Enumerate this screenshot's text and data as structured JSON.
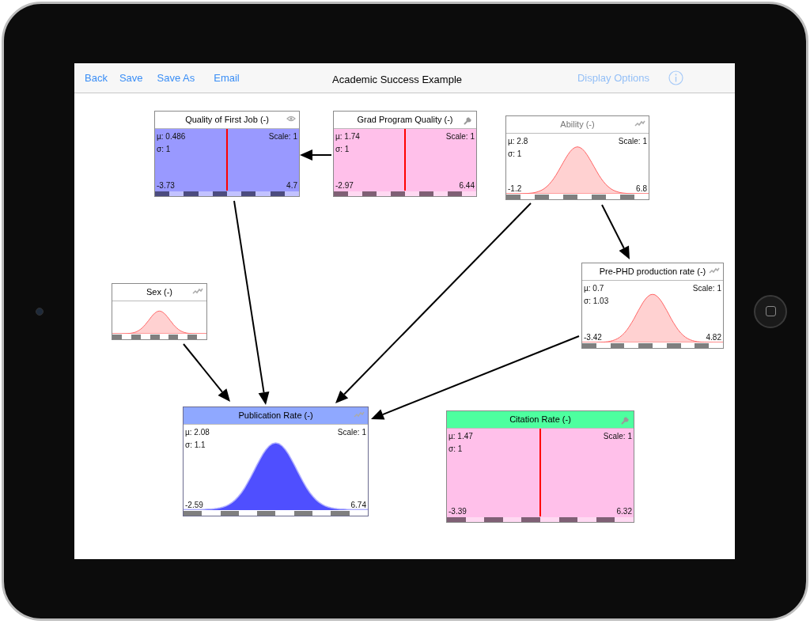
{
  "toolbar": {
    "left_buttons": [
      {
        "label": "Back"
      },
      {
        "label": "Save"
      },
      {
        "label": "Save As"
      },
      {
        "label": "Email"
      }
    ],
    "title": "Academic Success Example",
    "right_button": {
      "label": "Display Options",
      "disabled": true
    }
  },
  "nodes": [
    {
      "title": "Quality of First Job (-)",
      "kind": "observed",
      "dimmed": false,
      "selected": false,
      "highlighted": false,
      "mu": "µ: 0.486",
      "sigma": "σ: 1",
      "scale": "Scale: 1",
      "min": "-3.73",
      "max": "4.7"
    },
    {
      "title": "Grad Program Quality (-)",
      "kind": "fixed",
      "dimmed": false,
      "selected": false,
      "highlighted": false,
      "mu": "µ: 1.74",
      "sigma": "σ: 1",
      "scale": "Scale: 1",
      "min": "-2.97",
      "max": "6.44"
    },
    {
      "title": "Ability (-)",
      "kind": "distribution",
      "dimmed": true,
      "selected": false,
      "highlighted": false,
      "mu": "µ: 2.8",
      "sigma": "σ: 1",
      "scale": "Scale: 1",
      "min": "-1.2",
      "max": "6.8"
    },
    {
      "title": "Pre-PHD production rate (-)",
      "kind": "distribution",
      "dimmed": false,
      "selected": false,
      "highlighted": false,
      "mu": "µ: 0.7",
      "sigma": "σ: 1.03",
      "scale": "Scale: 1",
      "min": "-3.42",
      "max": "4.82"
    },
    {
      "title": "Sex (-)",
      "kind": "distribution",
      "dimmed": false,
      "selected": false,
      "highlighted": false
    },
    {
      "title": "Publication Rate (-)",
      "kind": "distribution",
      "dimmed": false,
      "selected": true,
      "highlighted": false,
      "mu": "µ: 2.08",
      "sigma": "σ: 1.1",
      "scale": "Scale: 1",
      "min": "-2.59",
      "max": "6.74"
    },
    {
      "title": "Citation Rate (-)",
      "kind": "fixed",
      "dimmed": false,
      "selected": false,
      "highlighted": true,
      "mu": "µ: 1.47",
      "sigma": "σ: 1",
      "scale": "Scale: 1",
      "min": "-3.39",
      "max": "6.32"
    }
  ]
}
